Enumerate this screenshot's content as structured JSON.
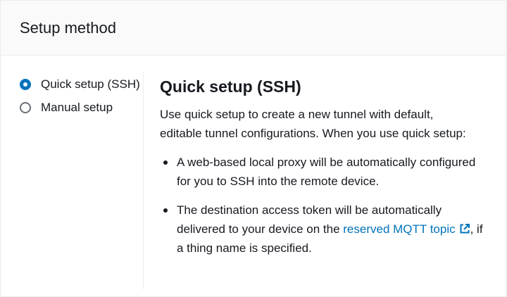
{
  "header": {
    "title": "Setup method"
  },
  "options": [
    {
      "label": "Quick setup (SSH)",
      "selected": true
    },
    {
      "label": "Manual setup",
      "selected": false
    }
  ],
  "detail": {
    "title": "Quick setup (SSH)",
    "description": "Use quick setup to create a new tunnel with default, editable tunnel configurations. When you use quick setup:",
    "bullet_1": "A web-based local proxy will be automatically configured for you to SSH into the remote device.",
    "bullet_2_prefix": "The destination access token will be automatically delivered to your device on the ",
    "bullet_2_link": "reserved MQTT topic",
    "bullet_2_suffix": ", if a thing name is specified."
  },
  "colors": {
    "accent": "#0073bb",
    "text": "#16191f",
    "header_bg": "#fafafa"
  },
  "icons": {
    "external_link": "external-link-icon"
  }
}
